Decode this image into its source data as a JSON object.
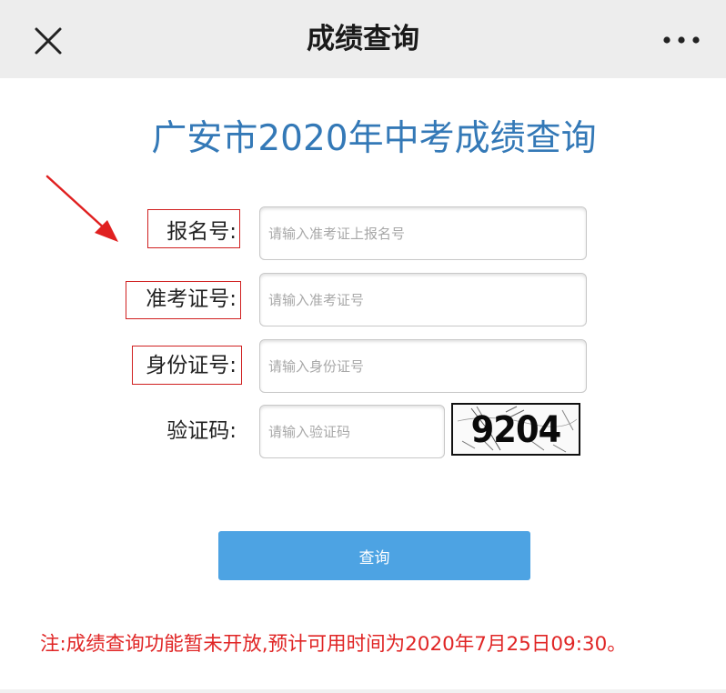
{
  "nav": {
    "title": "成绩查询",
    "close_icon": "close-icon",
    "more_icon": "more-icon"
  },
  "page": {
    "title": "广安市2020年中考成绩查询"
  },
  "form": {
    "registration": {
      "label": "报名号:",
      "placeholder": "请输入准考证上报名号",
      "value": ""
    },
    "exam_ticket": {
      "label": "准考证号:",
      "placeholder": "请输入准考证号",
      "value": ""
    },
    "id_card": {
      "label": "身份证号:",
      "placeholder": "请输入身份证号",
      "value": ""
    },
    "captcha": {
      "label": "验证码:",
      "placeholder": "请输入验证码",
      "value": "",
      "image_text": "9204"
    }
  },
  "submit": {
    "label": "查询"
  },
  "notice": {
    "text": "注:成绩查询功能暂未开放,预计可用时间为2020年7月25日09:30。"
  },
  "colors": {
    "title_blue": "#3479b7",
    "button_blue": "#4da3e3",
    "notice_red": "#e02525",
    "annotation_red": "#d02020",
    "topbar_gray": "#ededed"
  }
}
